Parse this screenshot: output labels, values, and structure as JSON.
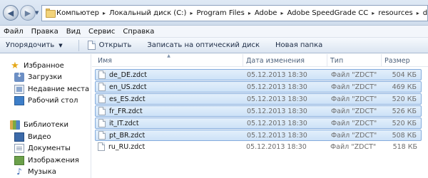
{
  "address": {
    "crumbs": [
      "Компьютер",
      "Локальный диск (C:)",
      "Program Files",
      "Adobe",
      "Adobe SpeedGrade CC",
      "resources",
      "dict"
    ]
  },
  "menu": [
    "Файл",
    "Правка",
    "Вид",
    "Сервис",
    "Справка"
  ],
  "toolbar": {
    "organize": "Упорядочить",
    "open": "Открыть",
    "burn": "Записать на оптический диск",
    "new_folder": "Новая папка"
  },
  "nav": {
    "favorites": "Избранное",
    "downloads": "Загрузки",
    "recent": "Недавние места",
    "desktop": "Рабочий стол",
    "libraries": "Библиотеки",
    "video": "Видео",
    "documents": "Документы",
    "pictures": "Изображения",
    "music": "Музыка"
  },
  "columns": {
    "name": "Имя",
    "date": "Дата изменения",
    "type": "Тип",
    "size": "Размер"
  },
  "files": [
    {
      "name": "de_DE.zdct",
      "date": "05.12.2013 18:30",
      "type": "Файл \"ZDCT\"",
      "size": "504 КБ",
      "selected": true
    },
    {
      "name": "en_US.zdct",
      "date": "05.12.2013 18:30",
      "type": "Файл \"ZDCT\"",
      "size": "469 КБ",
      "selected": true
    },
    {
      "name": "es_ES.zdct",
      "date": "05.12.2013 18:30",
      "type": "Файл \"ZDCT\"",
      "size": "520 КБ",
      "selected": true
    },
    {
      "name": "fr_FR.zdct",
      "date": "05.12.2013 18:30",
      "type": "Файл \"ZDCT\"",
      "size": "526 КБ",
      "selected": true
    },
    {
      "name": "it_IT.zdct",
      "date": "05.12.2013 18:30",
      "type": "Файл \"ZDCT\"",
      "size": "520 КБ",
      "selected": true
    },
    {
      "name": "pt_BR.zdct",
      "date": "05.12.2013 18:30",
      "type": "Файл \"ZDCT\"",
      "size": "508 КБ",
      "selected": true
    },
    {
      "name": "ru_RU.zdct",
      "date": "05.12.2013 18:30",
      "type": "Файл \"ZDCT\"",
      "size": "518 КБ",
      "selected": false
    }
  ]
}
